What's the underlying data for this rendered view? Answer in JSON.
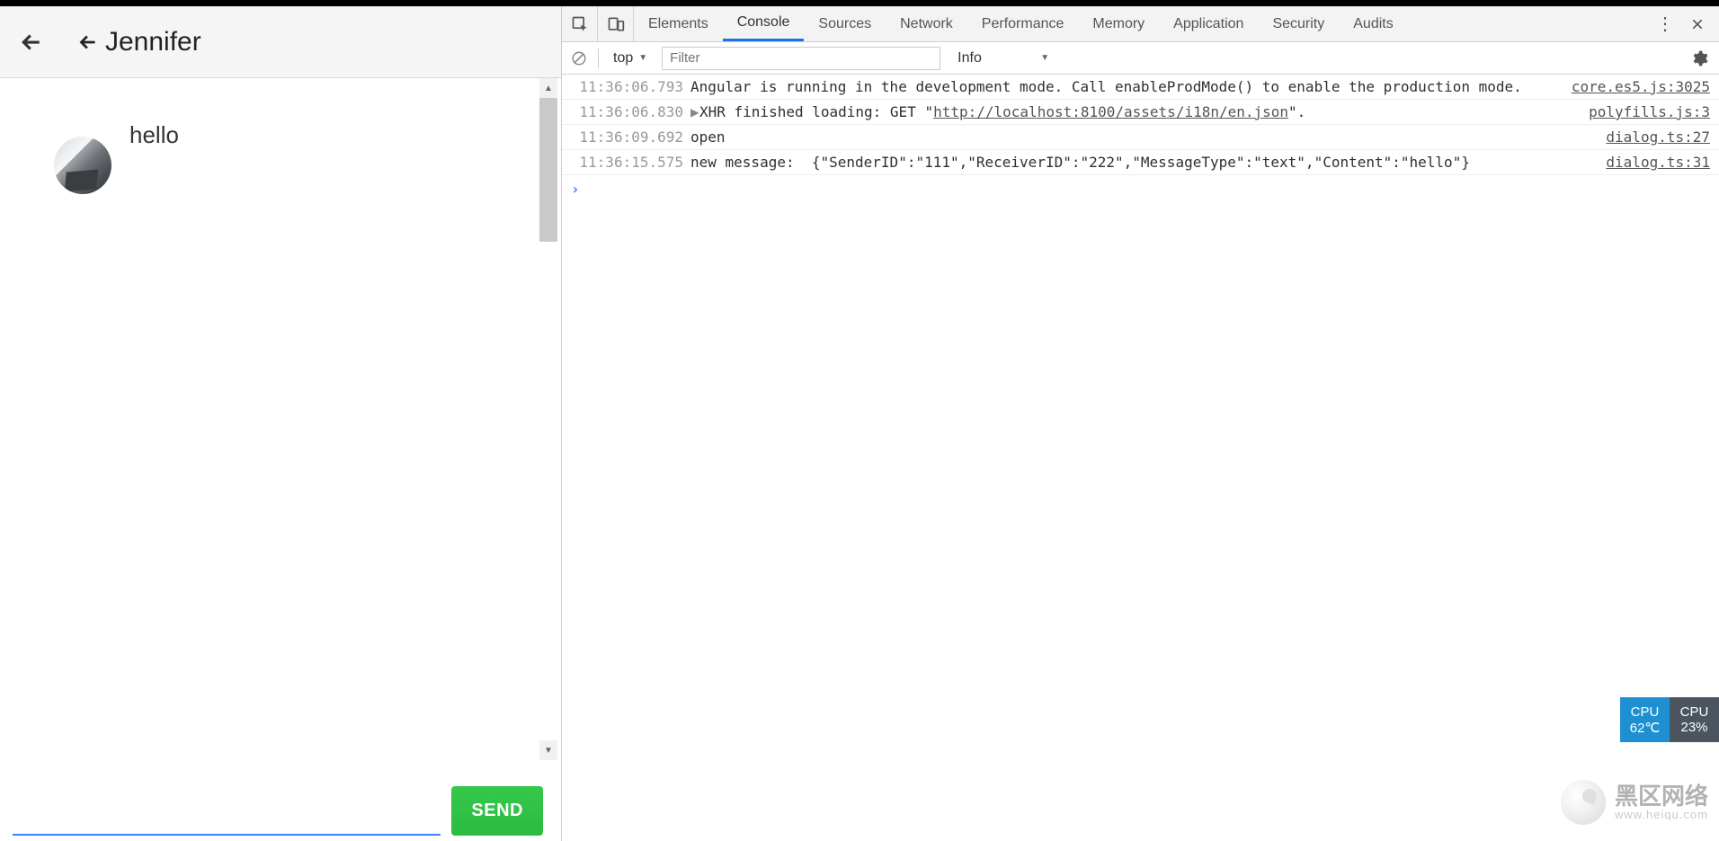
{
  "chat": {
    "contact_name": "Jennifer",
    "messages": [
      {
        "text": "hello"
      }
    ],
    "send_label": "SEND",
    "input_value": ""
  },
  "devtools": {
    "tabs": [
      "Elements",
      "Console",
      "Sources",
      "Network",
      "Performance",
      "Memory",
      "Application",
      "Security",
      "Audits"
    ],
    "active_tab_index": 1,
    "toolbar": {
      "context_label": "top",
      "filter_placeholder": "Filter",
      "level_label": "Info"
    },
    "logs": [
      {
        "ts": "11:36:06.793",
        "expand": false,
        "msg_pre": "Angular is running in the development mode. Call enableProdMode() to enable the production mode.",
        "src": "core.es5.js:3025"
      },
      {
        "ts": "11:36:06.830",
        "expand": true,
        "msg_pre": "XHR finished loading: GET \"",
        "link": "http://localhost:8100/assets/i18n/en.json",
        "msg_post": "\".",
        "src": "polyfills.js:3"
      },
      {
        "ts": "11:36:09.692",
        "expand": false,
        "msg_pre": "open",
        "src": "dialog.ts:27"
      },
      {
        "ts": "11:36:15.575",
        "expand": false,
        "msg_pre": "new message:  {\"SenderID\":\"111\",\"ReceiverID\":\"222\",\"MessageType\":\"text\",\"Content\":\"hello\"}",
        "src": "dialog.ts:31"
      }
    ]
  },
  "cpu": [
    {
      "label": "CPU",
      "value": "62℃"
    },
    {
      "label": "CPU",
      "value": "23%"
    }
  ],
  "watermark": {
    "title": "黑区网络",
    "subtitle": "www.heiqu.com"
  }
}
